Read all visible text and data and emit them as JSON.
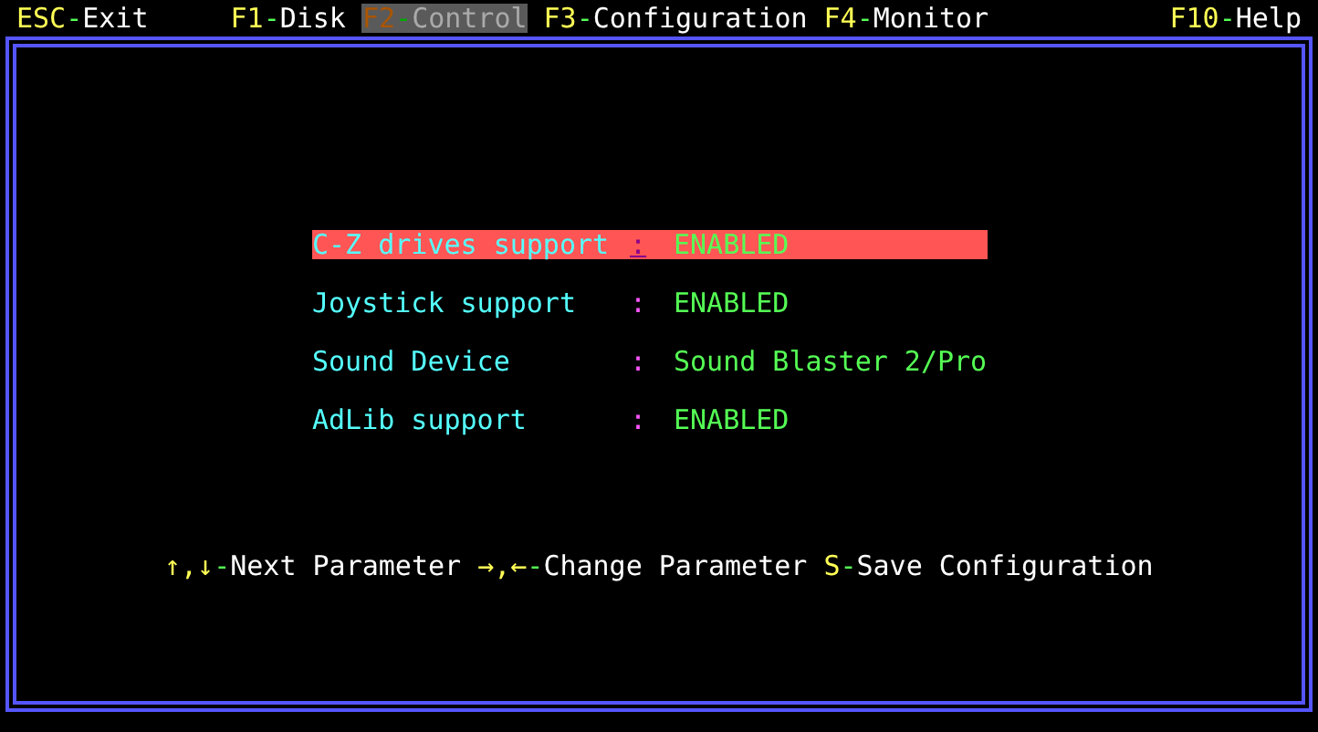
{
  "menu": [
    {
      "key": "ESC",
      "dash": "-",
      "label": "Exit",
      "selected": false
    },
    {
      "key": "F1",
      "dash": "-",
      "label": "Disk",
      "selected": false
    },
    {
      "key": "F2",
      "dash": "-",
      "label": "Control",
      "selected": true
    },
    {
      "key": "F3",
      "dash": "-",
      "label": "Configuration",
      "selected": false
    },
    {
      "key": "F4",
      "dash": "-",
      "label": "Monitor",
      "selected": false
    },
    {
      "key": "F10",
      "dash": "-",
      "label": "Help",
      "selected": false
    }
  ],
  "settings": [
    {
      "label": "C-Z drives support",
      "colon": ":",
      "value": "ENABLED",
      "selected": true
    },
    {
      "label": "Joystick support",
      "colon": ":",
      "value": "ENABLED",
      "selected": false
    },
    {
      "label": "Sound Device",
      "colon": ":",
      "value": "Sound Blaster 2/Pro",
      "selected": false
    },
    {
      "label": "AdLib support",
      "colon": ":",
      "value": "ENABLED",
      "selected": false
    }
  ],
  "hints": [
    {
      "key": "↑,↓",
      "dash": "-",
      "label": "Next Parameter"
    },
    {
      "key": "→,←",
      "dash": "-",
      "label": "Change Parameter"
    },
    {
      "key": "S",
      "dash": "-",
      "label": "Save Configuration"
    }
  ]
}
